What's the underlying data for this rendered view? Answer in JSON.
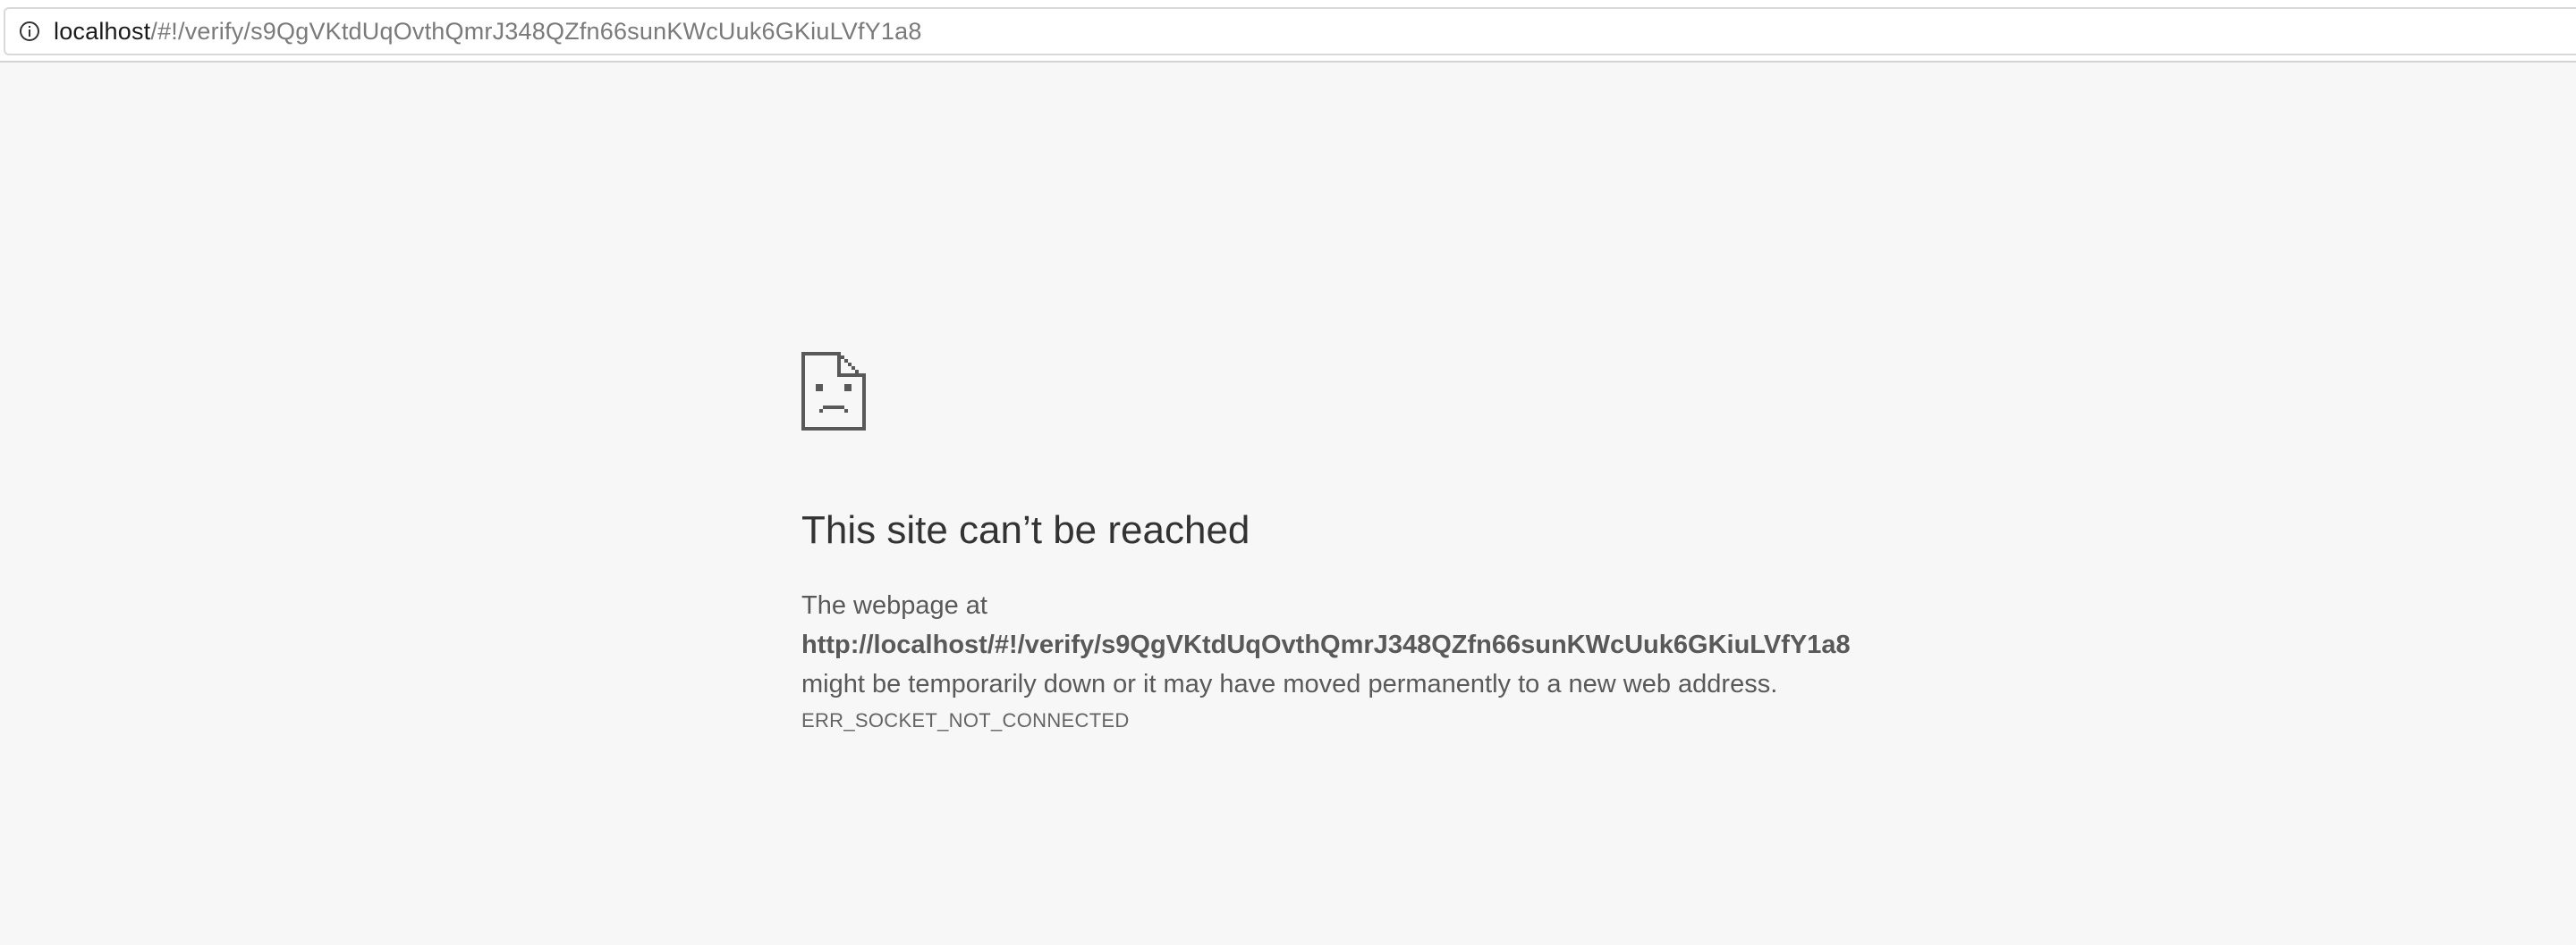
{
  "address_bar": {
    "icon": "info-icon",
    "url_host": "localhost",
    "url_path": "/#!/verify/s9QgVKtdUqOvthQmrJ348QZfn66sunKWcUuk6GKiuLVfY1a8"
  },
  "error_page": {
    "icon": "sad-page-icon",
    "title": "This site can’t be reached",
    "intro": "The webpage at",
    "url": "http://localhost/#!/verify/s9QgVKtdUqOvthQmrJ348QZfn66sunKWcUuk6GKiuLVfY1a8",
    "message": " might be temporarily down or it may have moved permanently to a new web address.",
    "error_code": "ERR_SOCKET_NOT_CONNECTED"
  },
  "colors": {
    "page_background": "#f7f7f7",
    "title_text": "#333333",
    "body_text": "#595959",
    "url_path_text": "#7a7a7a"
  }
}
